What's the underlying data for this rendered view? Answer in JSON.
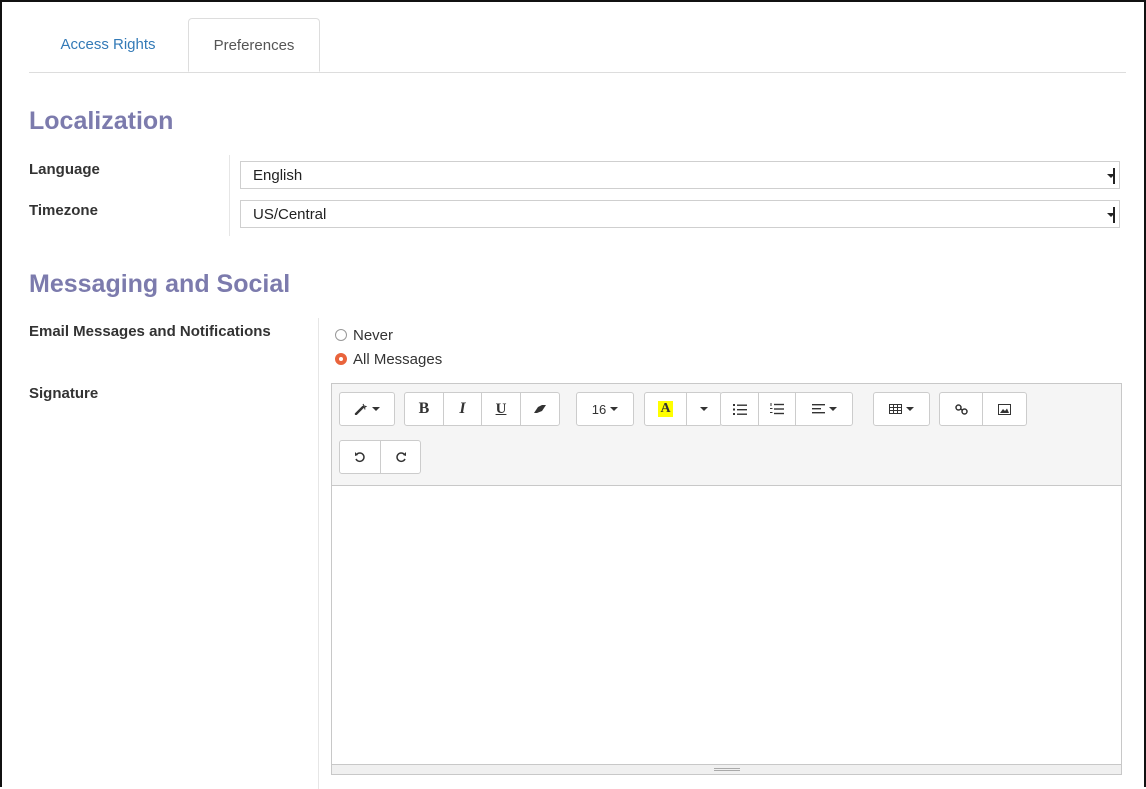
{
  "tabs": [
    {
      "label": "Access Rights",
      "active": false
    },
    {
      "label": "Preferences",
      "active": true
    }
  ],
  "localization": {
    "title": "Localization",
    "language": {
      "label": "Language",
      "value": "English"
    },
    "timezone": {
      "label": "Timezone",
      "value": "US/Central"
    }
  },
  "messaging": {
    "title": "Messaging and Social",
    "notifications_label": "Email Messages and Notifications",
    "options": [
      {
        "label": "Never",
        "selected": false
      },
      {
        "label": "All Messages",
        "selected": true
      }
    ],
    "signature_label": "Signature"
  },
  "toolbar": {
    "font_size": "16",
    "bold": "B",
    "italic": "I",
    "underline": "U",
    "forecolor": "A",
    "icons": [
      "magic-wand-icon",
      "eraser-icon",
      "bullet-list-icon",
      "numbered-list-icon",
      "align-icon",
      "table-icon",
      "link-icon",
      "image-icon",
      "undo-icon",
      "redo-icon"
    ]
  },
  "colors": {
    "heading": "#7c7bad",
    "tab_link": "#337ab7",
    "radio_selected": "#e9643c",
    "highlight": "#ffff00"
  }
}
